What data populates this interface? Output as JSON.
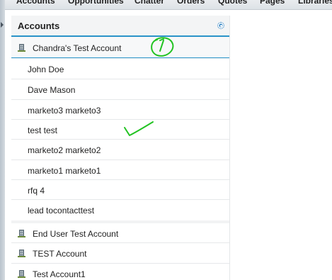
{
  "nav": {
    "tabs": [
      "Accounts",
      "Opportunities",
      "Chatter",
      "Orders",
      "Quotes",
      "Pages",
      "Libraries"
    ]
  },
  "panel": {
    "title": "Accounts",
    "settings_icon": "gear-icon",
    "selected_account": {
      "name": "Chandra's Test Account",
      "icon": "building-icon"
    },
    "contacts": [
      "John Doe",
      "Dave Mason",
      "marketo3 marketo3",
      "test test",
      "marketo2 marketo2",
      "marketo1 marketo1",
      "rfq 4",
      "lead tocontacttest"
    ],
    "accounts": [
      {
        "name": "End User Test Account",
        "icon": "building-icon"
      },
      {
        "name": "TEST Account",
        "icon": "building-icon"
      },
      {
        "name": "Test Account1",
        "icon": "building-icon"
      }
    ]
  },
  "annotations": {
    "color": "#22c322",
    "marks": [
      "circled-one",
      "checkmark"
    ]
  },
  "colors": {
    "accent": "#2a94c9",
    "panel_bg": "#f2f3f4"
  }
}
